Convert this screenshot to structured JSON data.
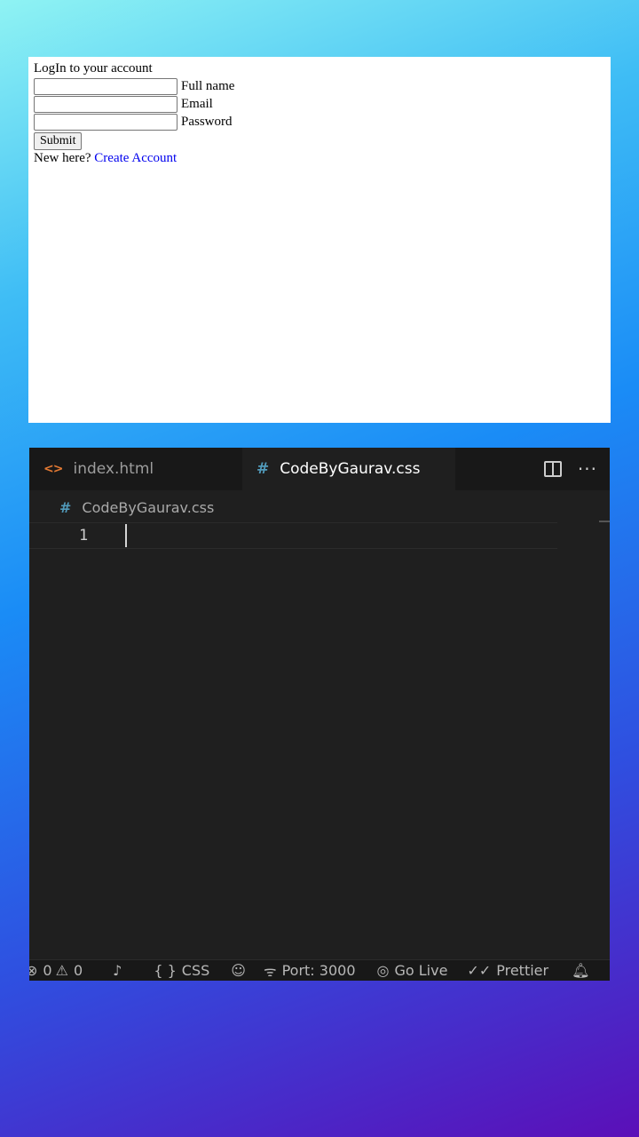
{
  "preview": {
    "title": "LogIn to your account",
    "fields": [
      {
        "label": "Full name",
        "value": ""
      },
      {
        "label": "Email",
        "value": ""
      },
      {
        "label": "Password",
        "value": ""
      }
    ],
    "submit_label": "Submit",
    "new_here_text": "New here?",
    "create_account_link": "Create Account"
  },
  "editor": {
    "tabs": [
      {
        "label": "index.html",
        "icon": "html-icon",
        "active": false
      },
      {
        "label": "CodeByGaurav.css",
        "icon": "css-hash-icon",
        "active": true
      }
    ],
    "breadcrumb": "CodeByGaurav.css",
    "line_number": "1",
    "status": {
      "errors": "0",
      "warnings": "0",
      "language": "CSS",
      "port": "Port: 3000",
      "go_live": "Go Live",
      "prettier": "Prettier"
    }
  }
}
